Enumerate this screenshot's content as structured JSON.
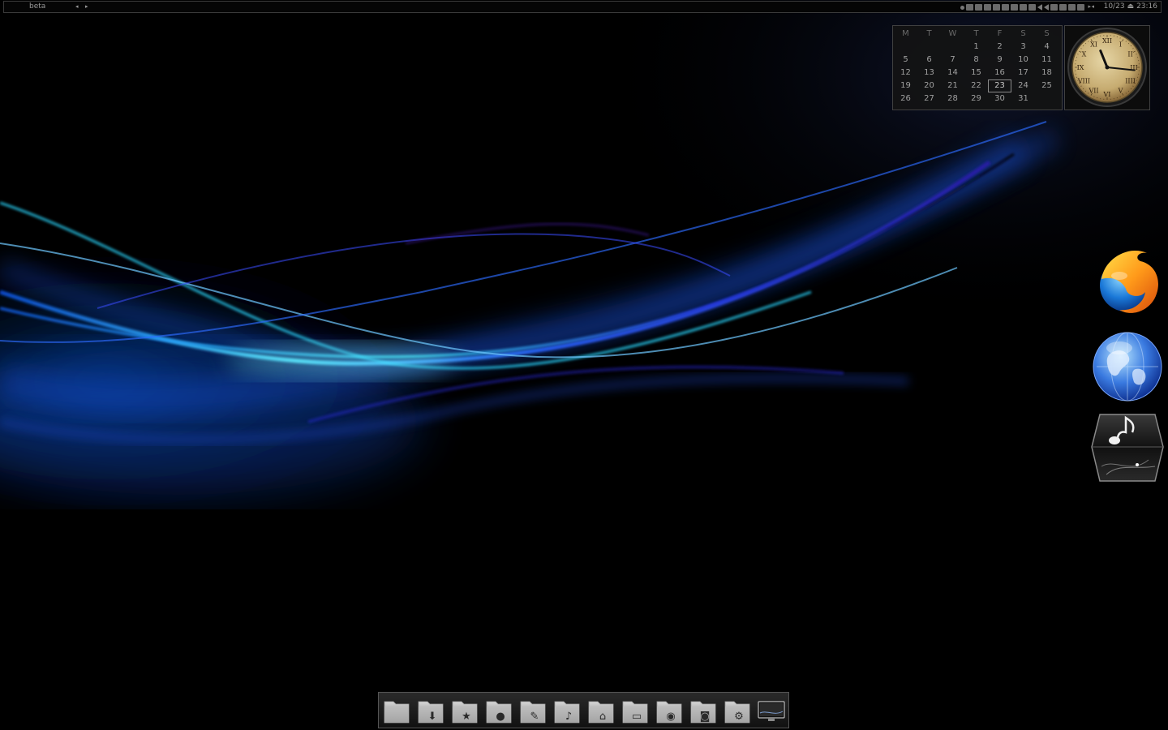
{
  "panel": {
    "workspace": "beta",
    "date": "10/23",
    "time": "23:16",
    "tray_icons": [
      "network-icon",
      "settings-icon",
      "bluetooth-icon",
      "drive-icon",
      "cpu-icon",
      "pointer-icon",
      "printer-icon",
      "keyboard-icon",
      "volume-icon",
      "arrow-icon",
      "screen-icon",
      "sync-icon",
      "hand-icon",
      "refresh-icon"
    ]
  },
  "calendar": {
    "weekdays": [
      "M",
      "T",
      "W",
      "T",
      "F",
      "S",
      "S"
    ],
    "weeks": [
      [
        "",
        "",
        "",
        "1",
        "2",
        "3",
        "4"
      ],
      [
        "5",
        "6",
        "7",
        "8",
        "9",
        "10",
        "11"
      ],
      [
        "12",
        "13",
        "14",
        "15",
        "16",
        "17",
        "18"
      ],
      [
        "19",
        "20",
        "21",
        "22",
        "23",
        "24",
        "25"
      ],
      [
        "26",
        "27",
        "28",
        "29",
        "30",
        "31",
        ""
      ]
    ],
    "today": "23"
  },
  "clock": {
    "hour": 11,
    "minute": 16
  },
  "launchers": [
    {
      "name": "firefox-launcher",
      "icon": "firefox-icon"
    },
    {
      "name": "browser-launcher",
      "icon": "globe-icon"
    },
    {
      "name": "music-launcher",
      "icon": "music-note-icon"
    }
  ],
  "dock": {
    "items": [
      {
        "name": "folder-icon"
      },
      {
        "name": "folder-download-icon"
      },
      {
        "name": "folder-favorites-icon"
      },
      {
        "name": "folder-user-icon"
      },
      {
        "name": "folder-tools-icon"
      },
      {
        "name": "folder-music-icon"
      },
      {
        "name": "folder-home-icon"
      },
      {
        "name": "folder-images-icon"
      },
      {
        "name": "folder-web-icon"
      },
      {
        "name": "folder-camera-icon"
      },
      {
        "name": "folder-settings-icon"
      },
      {
        "name": "monitor-icon"
      }
    ]
  },
  "colors": {
    "accent": "#1b6fff",
    "wallpaper_glow": "#18c8ff"
  }
}
